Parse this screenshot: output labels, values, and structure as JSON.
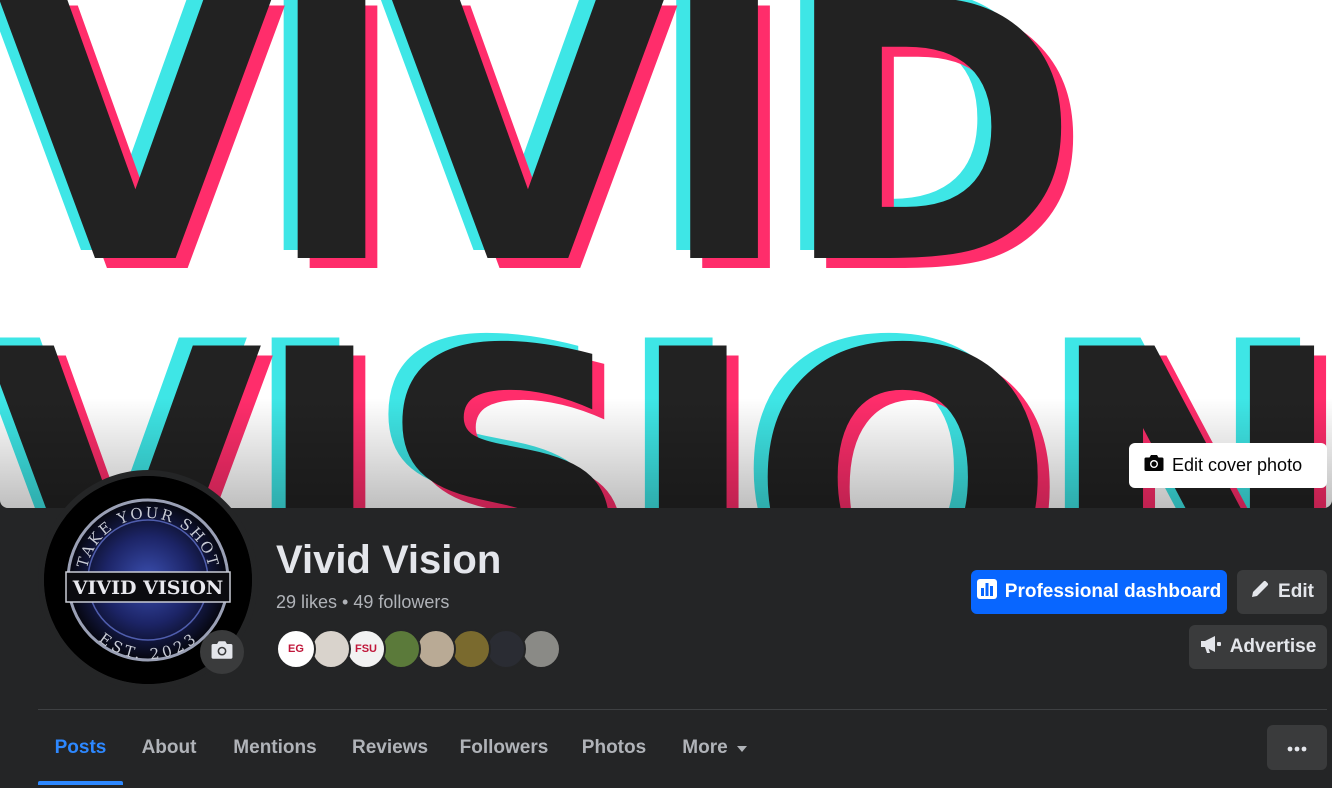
{
  "cover": {
    "line1": "VIVID",
    "line2": "VISION",
    "edit_label": "Edit cover photo"
  },
  "avatar": {
    "top_text": "TAKE YOUR SHOT",
    "main_text": "VIVID VISION",
    "bottom_text": "EST. 2023"
  },
  "page": {
    "name": "Vivid Vision",
    "likes": "29 likes",
    "separator": "•",
    "followers": "49 followers"
  },
  "follower_avatars": [
    {
      "label": "EG",
      "color": "#ffffff"
    },
    {
      "label": "",
      "color": "#d9d3cc"
    },
    {
      "label": "FSU",
      "color": "#f2f2f2"
    },
    {
      "label": "",
      "color": "#5b7a3a"
    },
    {
      "label": "",
      "color": "#b9aa95"
    },
    {
      "label": "",
      "color": "#7a6a2e"
    },
    {
      "label": "",
      "color": "#2a2c33"
    },
    {
      "label": "",
      "color": "#8a8a86"
    }
  ],
  "actions": {
    "dashboard_label": "Professional dashboard",
    "edit_label": "Edit",
    "advertise_label": "Advertise"
  },
  "tabs": [
    {
      "label": "Posts",
      "active": true
    },
    {
      "label": "About"
    },
    {
      "label": "Mentions"
    },
    {
      "label": "Reviews"
    },
    {
      "label": "Followers"
    },
    {
      "label": "Photos"
    },
    {
      "label": "More"
    }
  ],
  "colors": {
    "accent": "#0866ff",
    "tab_active": "#2d88ff",
    "background": "#242526",
    "cover_cyan": "#3ee6e6",
    "cover_pink": "#ff2d6b"
  }
}
